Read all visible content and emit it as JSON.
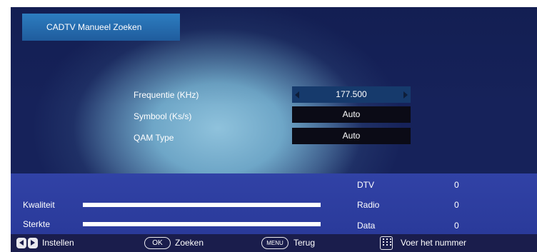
{
  "title": "CADTV Manueel Zoeken",
  "params": [
    {
      "label": "Frequentie (KHz)",
      "value": "177.500"
    },
    {
      "label": "Symbool (Ks/s)",
      "value": "Auto"
    },
    {
      "label": "QAM Type",
      "value": "Auto"
    }
  ],
  "signal": {
    "quality_label": "Kwaliteit",
    "strength_label": "Sterkte"
  },
  "stats": [
    {
      "label": "DTV",
      "value": "0"
    },
    {
      "label": "Radio",
      "value": "0"
    },
    {
      "label": "Data",
      "value": "0"
    }
  ],
  "footer": {
    "set_label": "Instellen",
    "ok_key": "OK",
    "search_label": "Zoeken",
    "menu_key": "MENU",
    "back_label": "Terug",
    "number_label": "Voer het nummer"
  },
  "colors": {
    "title_box": "#2d7dc0",
    "panel": "#3142a6",
    "footer": "#1a1d4c",
    "value_box": "#0b0b16",
    "selected_value_box": "#163a6c"
  }
}
